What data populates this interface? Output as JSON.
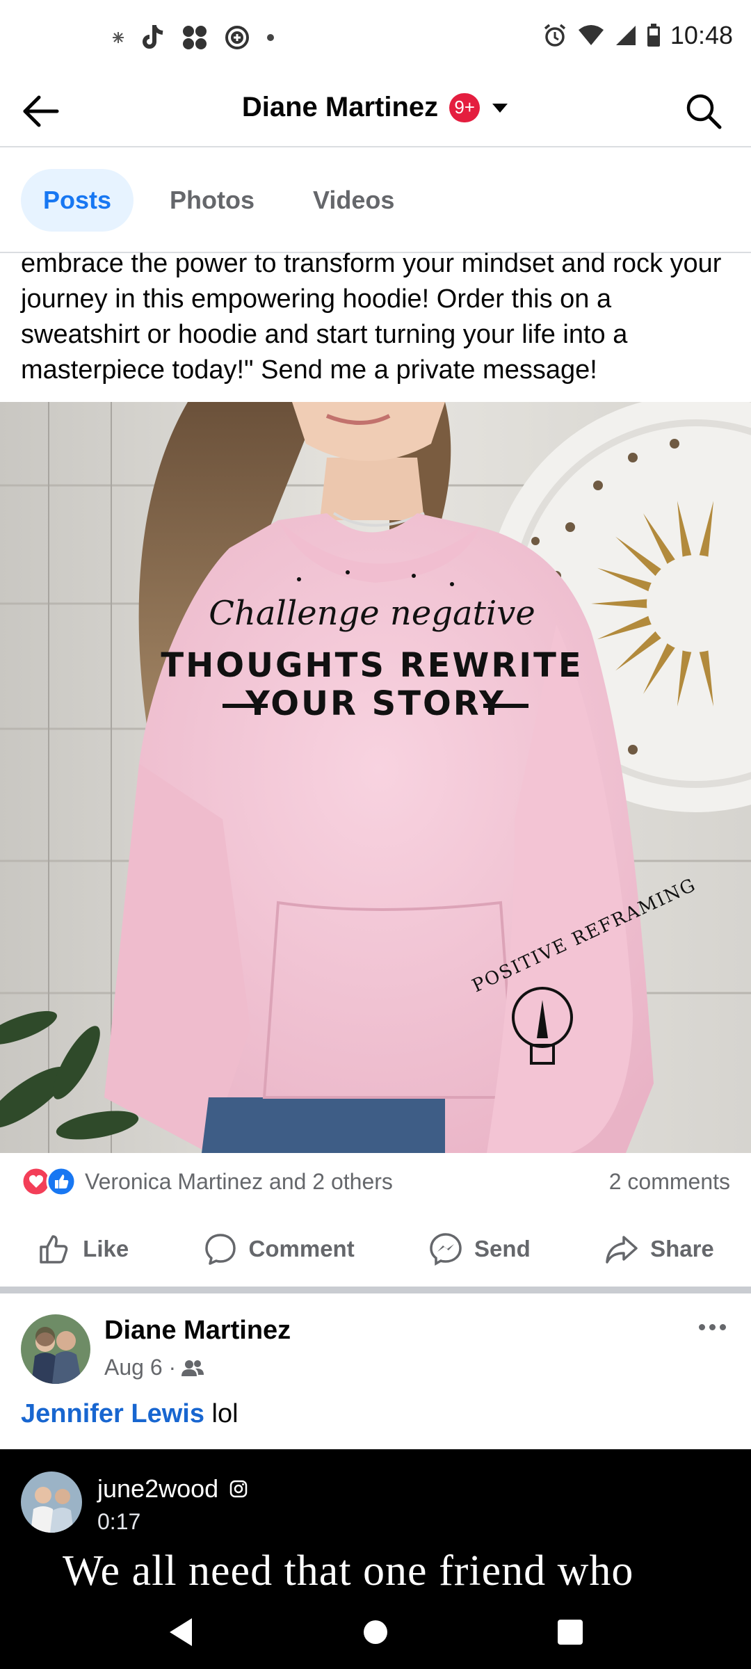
{
  "status_bar": {
    "time": "10:48",
    "left_icons": [
      "settings-spark-icon",
      "tiktok-icon",
      "nodes-icon",
      "add-circle-icon",
      "dot-icon"
    ],
    "right_icons": [
      "alarm-icon",
      "wifi-icon",
      "signal-icon",
      "battery-icon"
    ]
  },
  "header": {
    "title": "Diane Martinez",
    "badge": "9+",
    "back_icon": "arrow-left-icon",
    "search_icon": "search-icon"
  },
  "tabs": [
    {
      "label": "Posts",
      "active": true
    },
    {
      "label": "Photos",
      "active": false
    },
    {
      "label": "Videos",
      "active": false
    }
  ],
  "post": {
    "text": "embrace the power to transform your mindset and rock your journey in this empowering hoodie! Order this on a sweatshirt or hoodie and start turning your life into a masterpiece today!\" Send me a private message!",
    "image": {
      "script_text": "Challenge negative",
      "line2": "THOUGHTS REWRITE",
      "line3": "YOUR STORY",
      "sleeve_text": "POSITIVE REFRAMING"
    },
    "reactors": "Veronica Martinez and 2 others",
    "comments_count": "2 comments",
    "actions": {
      "like": "Like",
      "comment": "Comment",
      "send": "Send",
      "share": "Share"
    }
  },
  "comment": {
    "author": "Diane Martinez",
    "date": "Aug 6 ·",
    "mention": "Jennifer Lewis",
    "text": " lol"
  },
  "reel": {
    "username": "june2wood",
    "duration": "0:17",
    "caption": "We all need that one friend who"
  },
  "colors": {
    "brand_blue": "#1877f2",
    "tab_active_bg": "#e7f3ff",
    "badge_red": "#e41e3f",
    "hoodie_pink": "#f4c6d7",
    "secondary_text": "#65676b"
  }
}
